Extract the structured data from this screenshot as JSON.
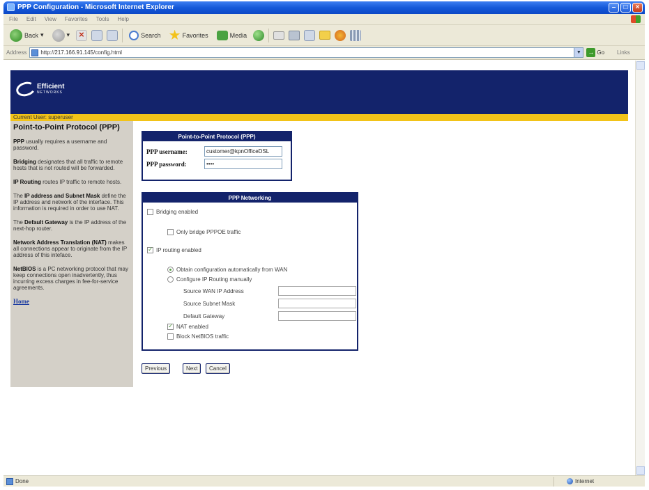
{
  "window": {
    "title": "PPP Configuration - Microsoft Internet Explorer"
  },
  "menu": [
    "File",
    "Edit",
    "View",
    "Favorites",
    "Tools",
    "Help"
  ],
  "toolbar": {
    "back": "Back",
    "search": "Search",
    "favorites": "Favorites",
    "media": "Media"
  },
  "address": {
    "label": "Address",
    "url": "http://217.166.91.145/config.html",
    "go": "Go",
    "links": "Links"
  },
  "banner": {
    "logo_line1": "Efficient",
    "logo_line2": "NETWORKS"
  },
  "userbar": {
    "text": "Current User: superuser"
  },
  "sidebar": {
    "title": "Point-to-Point Protocol (PPP)",
    "paragraphs": [
      {
        "bold": "PPP",
        "text": " usually requires a username and password."
      },
      {
        "bold": "Bridging",
        "text": " designates that all traffic to remote hosts that is not routed will be forwarded."
      },
      {
        "bold": "IP Routing",
        "text": " routes IP traffic to remote hosts."
      },
      {
        "pre": "The ",
        "bold": "IP address and Subnet Mask",
        "text": " define the IP address and network of the interface. This information is required in order to use NAT."
      },
      {
        "pre": "The ",
        "bold": "Default Gateway",
        "text": " is the IP address of the next-hop router."
      },
      {
        "bold": "Network Address Translation (NAT)",
        "text": " makes all connections appear to originate from the IP address of this inteface."
      },
      {
        "bold": "NetBIOS",
        "text": " is a PC networking protocol that may keep connections open inadvertently, thus incurring excess charges in fee-for-service agreements."
      }
    ],
    "home": "Home"
  },
  "ppp": {
    "header": "Point-to-Point Protocol (PPP)",
    "username_label": "PPP username:",
    "username_value": "customer@kpnOfficeDSL",
    "password_label": "PPP password:",
    "password_value": "••••"
  },
  "networking": {
    "header": "PPP Networking",
    "bridging": {
      "label": "Bridging enabled",
      "checked": false
    },
    "bridge_pppoe": {
      "label": "Only bridge PPPOE traffic",
      "checked": false
    },
    "ip_routing": {
      "label": "IP routing enabled",
      "checked": true
    },
    "obtain_auto": {
      "label": "Obtain configuration automatically from WAN",
      "selected": true
    },
    "configure_manual": {
      "label": "Configure IP Routing manually",
      "selected": false
    },
    "source_wan_ip": {
      "label": "Source WAN IP Address",
      "value": ""
    },
    "source_subnet": {
      "label": "Source Subnet Mask",
      "value": ""
    },
    "default_gateway": {
      "label": "Default Gateway",
      "value": ""
    },
    "nat": {
      "label": "NAT enabled",
      "checked": true
    },
    "block_netbios": {
      "label": "Block NetBIOS traffic",
      "checked": false
    }
  },
  "buttons": {
    "previous": "Previous",
    "next": "Next",
    "cancel": "Cancel"
  },
  "status": {
    "text": "Done",
    "zone": "Internet"
  },
  "colors": {
    "banner": "#13236b",
    "userbar": "#f2c318",
    "sidebar": "#d4d0c8"
  }
}
